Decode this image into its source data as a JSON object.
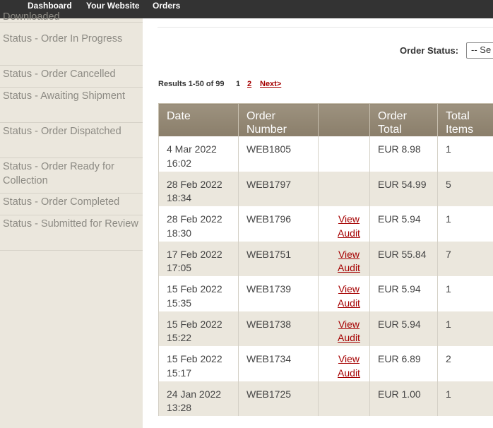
{
  "topnav": {
    "items": [
      {
        "label": "Dashboard"
      },
      {
        "label": "Your Website"
      },
      {
        "label": "Orders"
      }
    ]
  },
  "sidebar": {
    "clipped_label": "Downloaded",
    "items": [
      {
        "label": "Status - Order In Progress"
      },
      {
        "label": "Status - Order Cancelled"
      },
      {
        "label": "Status - Awaiting Shipment"
      },
      {
        "label": "Status - Order Dispatched"
      },
      {
        "label": "Status - Order Ready for Collection"
      },
      {
        "label": "Status - Order Completed"
      },
      {
        "label": "Status - Submitted for Review"
      }
    ]
  },
  "filter": {
    "order_status_label": "Order Status:",
    "order_status_value": "-- Se"
  },
  "pagination": {
    "results_text": "Results 1-50 of 99",
    "pages": [
      "1",
      "2"
    ],
    "current_page": "1",
    "next_label": "Next>"
  },
  "table": {
    "headers": [
      "Date",
      "Order Number",
      "",
      "Order Total",
      "Total Items"
    ],
    "link_labels": {
      "view": "View",
      "audit": "Audit"
    },
    "rows": [
      {
        "date": "4 Mar 2022",
        "time": "16:02",
        "order": "WEB1805",
        "audit": false,
        "total": "EUR 8.98",
        "items": "1"
      },
      {
        "date": "28 Feb 2022",
        "time": "18:34",
        "order": "WEB1797",
        "audit": false,
        "total": "EUR 54.99",
        "items": "5"
      },
      {
        "date": "28 Feb 2022",
        "time": "18:30",
        "order": "WEB1796",
        "audit": true,
        "total": "EUR 5.94",
        "items": "1"
      },
      {
        "date": "17 Feb 2022",
        "time": "17:05",
        "order": "WEB1751",
        "audit": true,
        "total": "EUR 55.84",
        "items": "7"
      },
      {
        "date": "15 Feb 2022",
        "time": "15:35",
        "order": "WEB1739",
        "audit": true,
        "total": "EUR 5.94",
        "items": "1"
      },
      {
        "date": "15 Feb 2022",
        "time": "15:22",
        "order": "WEB1738",
        "audit": true,
        "total": "EUR 5.94",
        "items": "1"
      },
      {
        "date": "15 Feb 2022",
        "time": "15:17",
        "order": "WEB1734",
        "audit": true,
        "total": "EUR 6.89",
        "items": "2"
      },
      {
        "date": "24 Jan 2022",
        "time": "13:28",
        "order": "WEB1725",
        "audit": false,
        "total": "EUR 1.00",
        "items": "1"
      }
    ]
  }
}
